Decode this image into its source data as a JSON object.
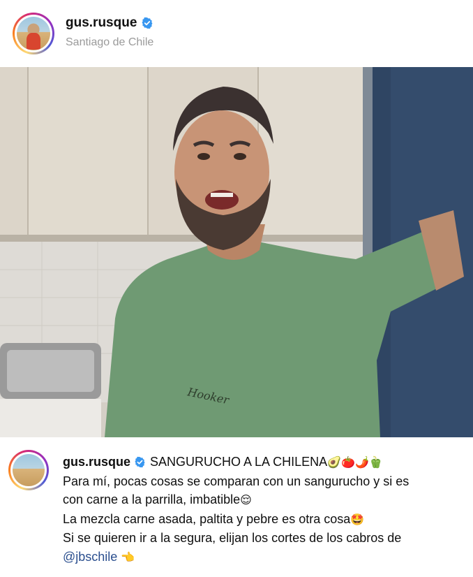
{
  "post": {
    "username": "gus.rusque",
    "location": "Santiago de Chile",
    "verified": true
  },
  "caption": {
    "username": "gus.rusque",
    "title": "SANGURUCHO A LA CHILENA",
    "title_emojis": "🥑🍅🌶️🫑",
    "line2": "Para mí, pocas cosas se comparan con un sangurucho y si es",
    "line3": "con carne a la parrilla, imbatible",
    "line3_emoji": "😌",
    "line4": "La mezcla carne asada, paltita y pebre es otra cosa",
    "line4_emoji": "🤩",
    "line5": "Si se quieren ir a la segura, elijan los cortes de los cabros de",
    "mention": "@jbschile",
    "mention_emoji": "👈"
  },
  "media": {
    "shirt_print": "Hooker"
  },
  "colors": {
    "verified_blue": "#3897f0",
    "mention_blue": "#2a4e8e",
    "location_gray": "#9a9a9a"
  },
  "icons": [
    "verified-badge-icon"
  ]
}
